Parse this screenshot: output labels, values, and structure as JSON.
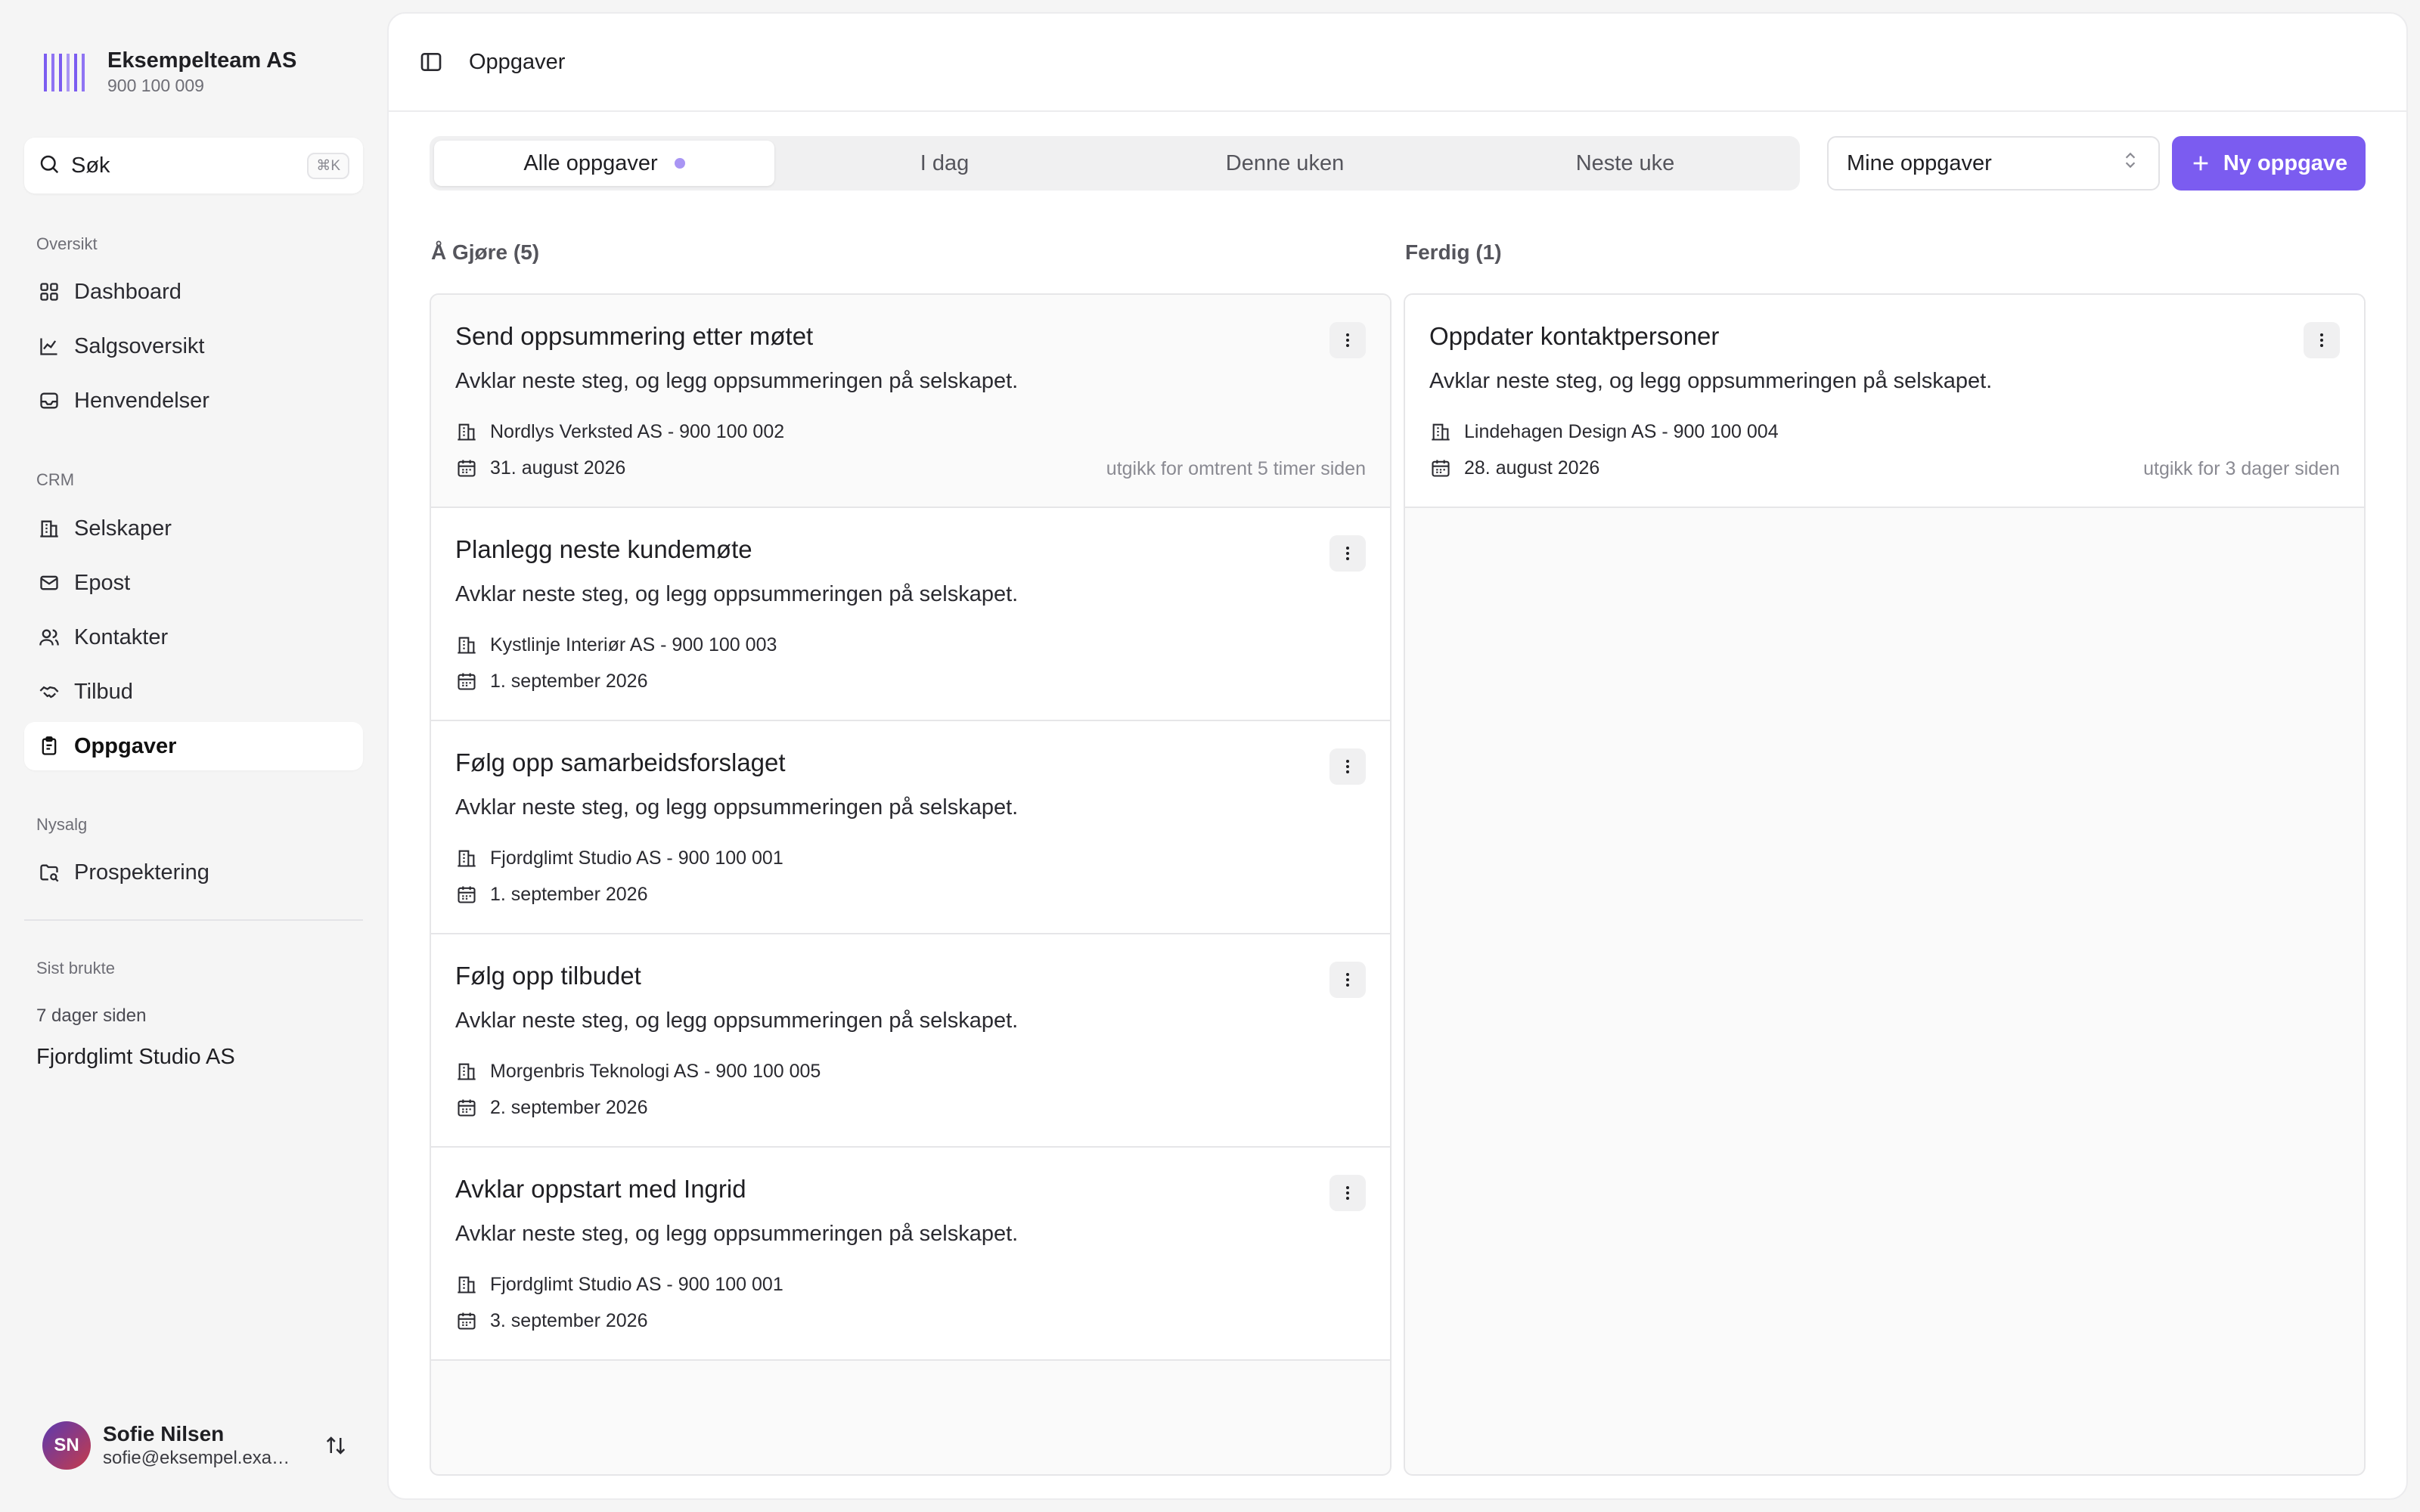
{
  "brand": {
    "name": "Eksempelteam AS",
    "org_number": "900 100 009"
  },
  "search": {
    "label": "Søk",
    "shortcut": "⌘K"
  },
  "sidebar": {
    "sections": {
      "overview": "Oversikt",
      "crm": "CRM",
      "nysalg": "Nysalg",
      "recent": "Sist brukte"
    },
    "items": {
      "dashboard": "Dashboard",
      "salgsoversikt": "Salgsoversikt",
      "henvendelser": "Henvendelser",
      "selskaper": "Selskaper",
      "epost": "Epost",
      "kontakter": "Kontakter",
      "tilbud": "Tilbud",
      "oppgaver": "Oppgaver",
      "prospektering": "Prospektering"
    },
    "active": "oppgaver",
    "recent": {
      "time": "7 dager siden",
      "item": "Fjordglimt Studio AS"
    }
  },
  "user": {
    "initials": "SN",
    "name": "Sofie Nilsen",
    "email": "sofie@eksempel.example.com"
  },
  "topbar": {
    "title": "Oppgaver"
  },
  "filters": {
    "tabs": [
      "Alle oppgaver",
      "I dag",
      "Denne uken",
      "Neste uke"
    ],
    "active_tab": 0,
    "select_value": "Mine oppgaver",
    "new_button": "Ny oppgave"
  },
  "columns": {
    "todo": {
      "title": "Å Gjøre (5)",
      "cards": [
        {
          "title": "Send oppsummering etter møtet",
          "description": "Avklar neste steg, og legg oppsummeringen på selskapet.",
          "company": "Nordlys Verksted AS - 900 100 002",
          "date": "31. august 2026",
          "due": "utgikk for omtrent 5 timer siden"
        },
        {
          "title": "Planlegg neste kundemøte",
          "description": "Avklar neste steg, og legg oppsummeringen på selskapet.",
          "company": "Kystlinje Interiør AS - 900 100 003",
          "date": "1. september 2026",
          "due": ""
        },
        {
          "title": "Følg opp samarbeidsforslaget",
          "description": "Avklar neste steg, og legg oppsummeringen på selskapet.",
          "company": "Fjordglimt Studio AS - 900 100 001",
          "date": "1. september 2026",
          "due": ""
        },
        {
          "title": "Følg opp tilbudet",
          "description": "Avklar neste steg, og legg oppsummeringen på selskapet.",
          "company": "Morgenbris Teknologi AS - 900 100 005",
          "date": "2. september 2026",
          "due": ""
        },
        {
          "title": "Avklar oppstart med Ingrid",
          "description": "Avklar neste steg, og legg oppsummeringen på selskapet.",
          "company": "Fjordglimt Studio AS - 900 100 001",
          "date": "3. september 2026",
          "due": ""
        }
      ]
    },
    "done": {
      "title": "Ferdig (1)",
      "cards": [
        {
          "title": "Oppdater kontaktpersoner",
          "description": "Avklar neste steg, og legg oppsummeringen på selskapet.",
          "company": "Lindehagen Design AS - 900 100 004",
          "date": "28. august 2026",
          "due": "utgikk for 3 dager siden"
        }
      ]
    }
  },
  "colors": {
    "accent": "#7b5cf0",
    "accent_dot": "#a995f4"
  }
}
